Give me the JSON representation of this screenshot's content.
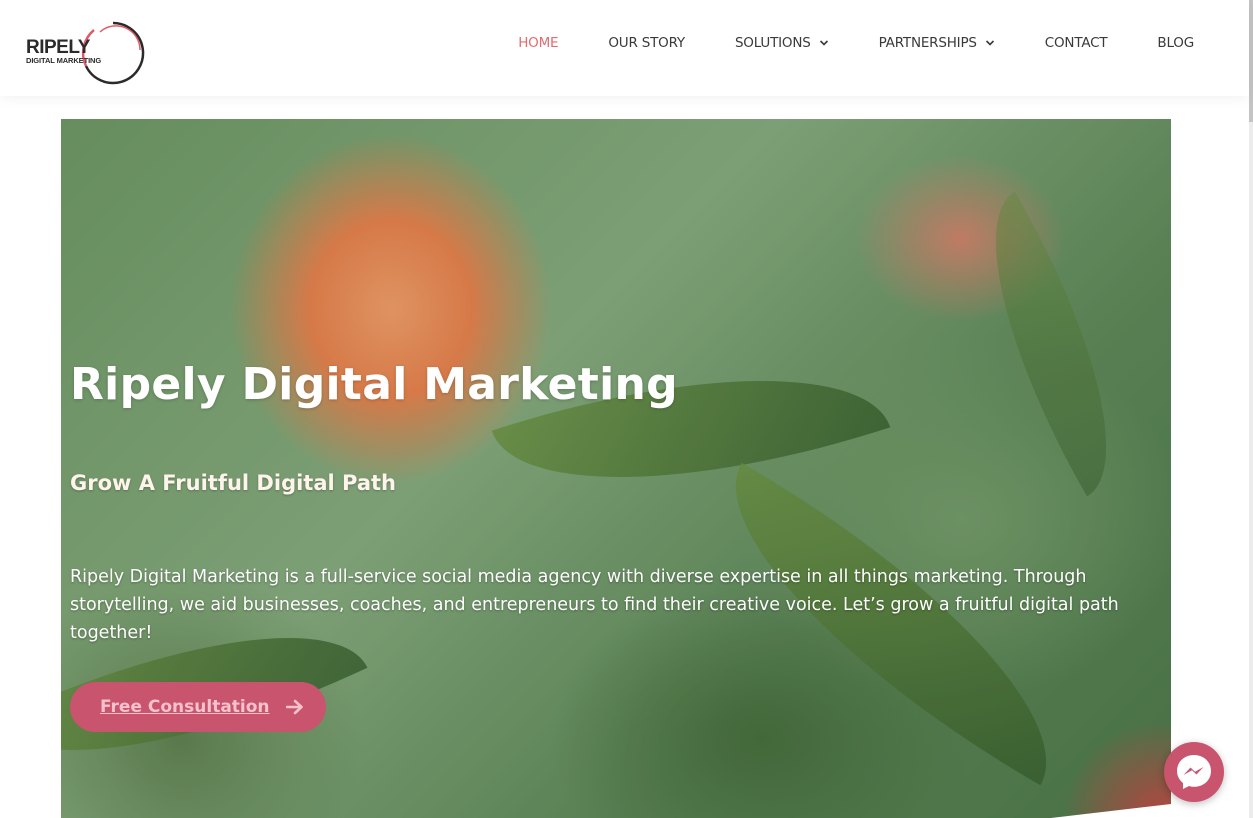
{
  "brand": {
    "logo_line1": "RIPELY",
    "logo_line2": "DIGITAL MARKETING",
    "ring_colors": [
      "#2b2b2b",
      "#e05b6a"
    ]
  },
  "nav": {
    "items": [
      {
        "label": "HOME",
        "active": true,
        "has_dropdown": false
      },
      {
        "label": "OUR STORY",
        "active": false,
        "has_dropdown": false
      },
      {
        "label": "SOLUTIONS",
        "active": false,
        "has_dropdown": true
      },
      {
        "label": "PARTNERSHIPS",
        "active": false,
        "has_dropdown": true
      },
      {
        "label": "CONTACT",
        "active": false,
        "has_dropdown": false
      },
      {
        "label": "BLOG",
        "active": false,
        "has_dropdown": false
      }
    ],
    "active_color": "#e26c6f"
  },
  "hero": {
    "title": "Ripely Digital Marketing",
    "subtitle": "Grow A Fruitful Digital Path",
    "body": "Ripely Digital Marketing is a full-service social media agency with diverse expertise in all things marketing. Through storytelling, we aid businesses, coaches, and entrepreneurs to find their creative voice. Let’s grow a fruitful digital path together!",
    "cta_label": "Free Consultation",
    "cta_icon": "arrow-right-icon",
    "background": "peach-tree-photo"
  },
  "messenger": {
    "icon": "messenger-icon",
    "color": "#c8546e"
  }
}
